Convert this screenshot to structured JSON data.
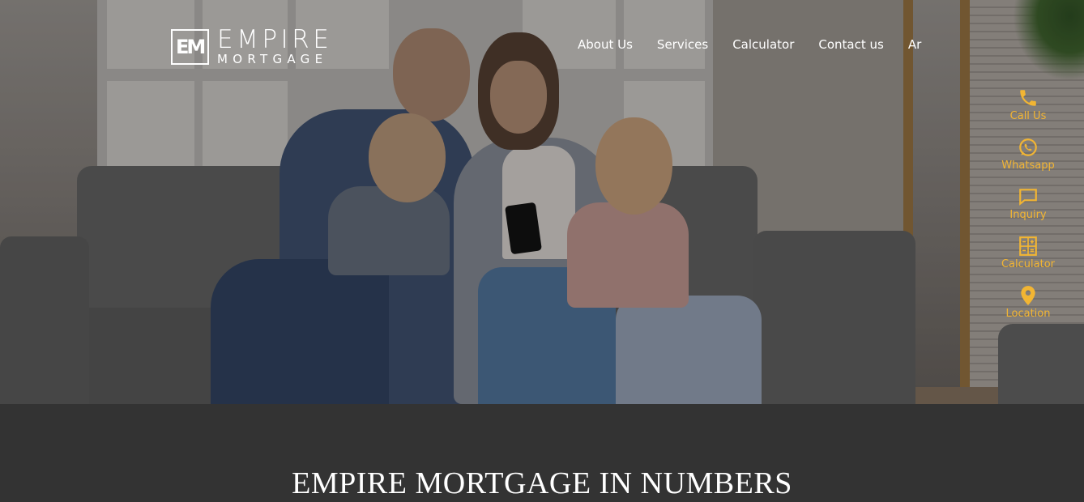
{
  "header": {
    "logo_mark": "EM",
    "logo_main": "EMPIRE",
    "logo_sub": "MORTGAGE",
    "nav": [
      {
        "label": "About Us"
      },
      {
        "label": "Services"
      },
      {
        "label": "Calculator"
      },
      {
        "label": "Contact us"
      },
      {
        "label": "Ar"
      }
    ]
  },
  "sidebar": {
    "accent": "#f2b533",
    "items": [
      {
        "label": "Call Us",
        "icon": "phone-icon"
      },
      {
        "label": "Whatsapp",
        "icon": "whatsapp-icon"
      },
      {
        "label": "Inquiry",
        "icon": "chat-bubble-icon"
      },
      {
        "label": "Calculator",
        "icon": "calculator-icon"
      },
      {
        "label": "Location",
        "icon": "location-pin-icon"
      }
    ]
  },
  "numbers": {
    "heading": "EMPIRE MORTGAGE IN NUMBERS"
  },
  "colors": {
    "section_bg": "#333333",
    "text": "#ffffff"
  }
}
